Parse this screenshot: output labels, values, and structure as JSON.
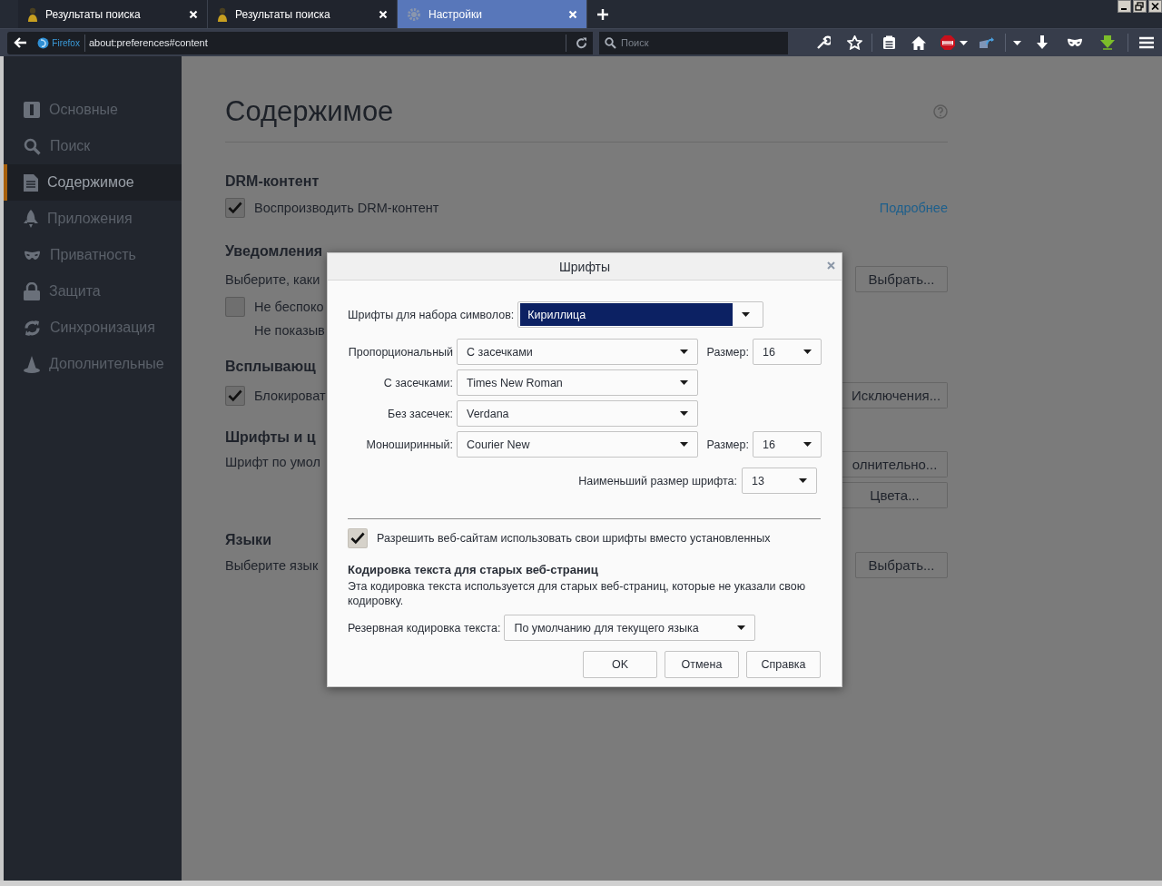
{
  "tabs": [
    {
      "title": "Результаты поиска",
      "selected": false
    },
    {
      "title": "Результаты поиска",
      "selected": false
    },
    {
      "title": "Настройки",
      "selected": true
    }
  ],
  "navbar": {
    "identity": "Firefox",
    "url": "about:preferences#content",
    "search": {
      "placeholder": "Поиск"
    }
  },
  "sidebar": {
    "items": [
      {
        "label": "Основные",
        "selected": false
      },
      {
        "label": "Поиск",
        "selected": false
      },
      {
        "label": "Содержимое",
        "selected": true
      },
      {
        "label": "Приложения",
        "selected": false
      },
      {
        "label": "Приватность",
        "selected": false
      },
      {
        "label": "Защита",
        "selected": false
      },
      {
        "label": "Синхронизация",
        "selected": false
      },
      {
        "label": "Дополнительные",
        "selected": false
      }
    ]
  },
  "content": {
    "title": "Содержимое",
    "drm": {
      "heading": "DRM-контент",
      "checkbox": {
        "label": "Воспроизводить DRM-контент",
        "checked": true
      },
      "link": "Подробнее"
    },
    "notifications": {
      "heading": "Уведомления",
      "text": "Выберите, каки",
      "button": "Выбрать...",
      "checkbox": {
        "label": "Не беспоко",
        "checked": false
      },
      "note": "Не показыв"
    },
    "popups": {
      "heading": "Всплывающ",
      "checkbox": {
        "label": "Блокироват",
        "checked": true
      },
      "button": "Исключения..."
    },
    "fonts": {
      "heading": "Шрифты и ц",
      "text": "Шрифт по умол",
      "buttons": [
        "олнительно...",
        "Цвета..."
      ]
    },
    "languages": {
      "heading": "Языки",
      "text": "Выберите язык",
      "button": "Выбрать..."
    }
  },
  "dialog": {
    "title": "Шрифты",
    "charset": {
      "label": "Шрифты для набора символов:",
      "value": "Кириллица"
    },
    "rows": [
      {
        "label": "Пропорциональный",
        "value": "С засечками",
        "size_label": "Размер:",
        "size": "16"
      },
      {
        "label": "С засечками:",
        "value": "Times New Roman"
      },
      {
        "label": "Без засечек:",
        "value": "Verdana"
      },
      {
        "label": "Моноширинный:",
        "value": "Courier New",
        "size_label": "Размер:",
        "size": "16"
      }
    ],
    "min_size": {
      "label": "Наименьший размер шрифта:",
      "value": "13"
    },
    "allow": {
      "label": "Разрешить веб-сайтам использовать свои шрифты вместо установленных",
      "checked": true
    },
    "encoding": {
      "heading": "Кодировка текста для старых веб-страниц",
      "description": "Эта кодировка текста используется для старых веб-страниц, которые не указали свою кодировку.",
      "label": "Резервная кодировка текста:",
      "value": "По умолчанию для текущего языка"
    },
    "buttons": [
      "OK",
      "Отмена",
      "Справка"
    ]
  }
}
